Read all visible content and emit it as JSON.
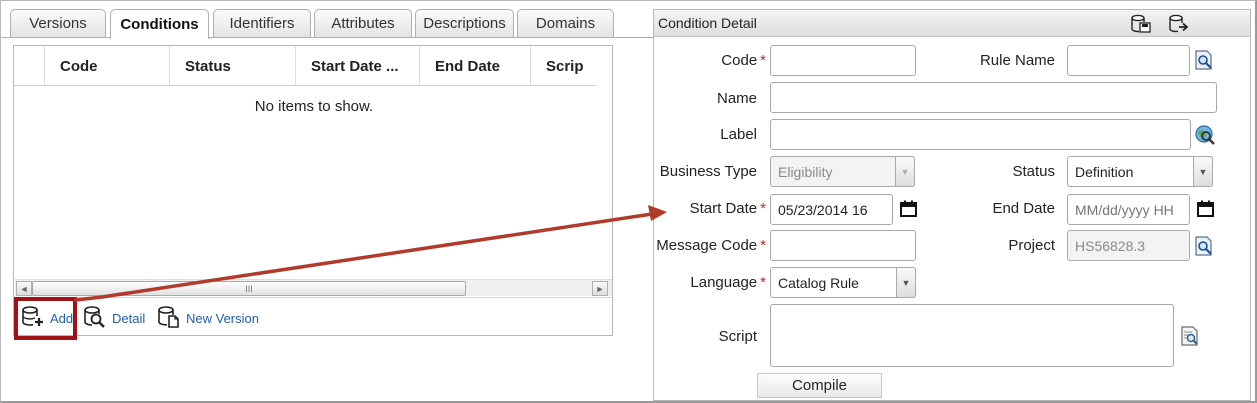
{
  "tabs": [
    {
      "label": "Versions",
      "active": false
    },
    {
      "label": "Conditions",
      "active": true
    },
    {
      "label": "Identifiers",
      "active": false
    },
    {
      "label": "Attributes",
      "active": false
    },
    {
      "label": "Descriptions",
      "active": false
    },
    {
      "label": "Domains",
      "active": false
    }
  ],
  "grid": {
    "columns": [
      "Code",
      "Status",
      "Start Date ...",
      "End Date",
      "Scrip"
    ],
    "empty_message": "No items to show.",
    "scroll_left_glyph": "◄",
    "scroll_right_glyph": "►",
    "scroll_thumb_grip": "III"
  },
  "toolbar": {
    "add_label": "Add",
    "detail_label": "Detail",
    "new_version_label": "New Version",
    "icons": [
      "database-add-icon",
      "database-search-icon",
      "database-document-icon"
    ]
  },
  "detail": {
    "title": "Condition Detail",
    "header_icons": [
      "database-save-icon",
      "database-export-icon"
    ],
    "fields": {
      "code": {
        "label": "Code",
        "required": true,
        "value": ""
      },
      "rule_name": {
        "label": "Rule Name",
        "required": false,
        "value": ""
      },
      "name": {
        "label": "Name",
        "required": false,
        "value": ""
      },
      "label": {
        "label": "Label",
        "required": false,
        "value": ""
      },
      "business_type": {
        "label": "Business Type",
        "required": false,
        "value": "Eligibility",
        "disabled": true
      },
      "status": {
        "label": "Status",
        "required": false,
        "value": "Definition"
      },
      "start_date": {
        "label": "Start Date",
        "required": true,
        "value": "05/23/2014 16"
      },
      "end_date": {
        "label": "End Date",
        "required": false,
        "value": "",
        "placeholder": "MM/dd/yyyy HH"
      },
      "message_code": {
        "label": "Message Code",
        "required": true,
        "value": ""
      },
      "project": {
        "label": "Project",
        "required": false,
        "value": "HS56828.3",
        "disabled": true
      },
      "language": {
        "label": "Language",
        "required": true,
        "value": "Catalog Rule"
      },
      "script": {
        "label": "Script",
        "required": false,
        "value": ""
      }
    },
    "required_marker": "*",
    "select_arrow_glyph": "▼",
    "compile_label": "Compile"
  },
  "colors": {
    "accent_link": "#1f5fb0",
    "required": "#c0292b",
    "highlight_box": "#a01218",
    "annotation_arrow": "#b23a2a"
  }
}
